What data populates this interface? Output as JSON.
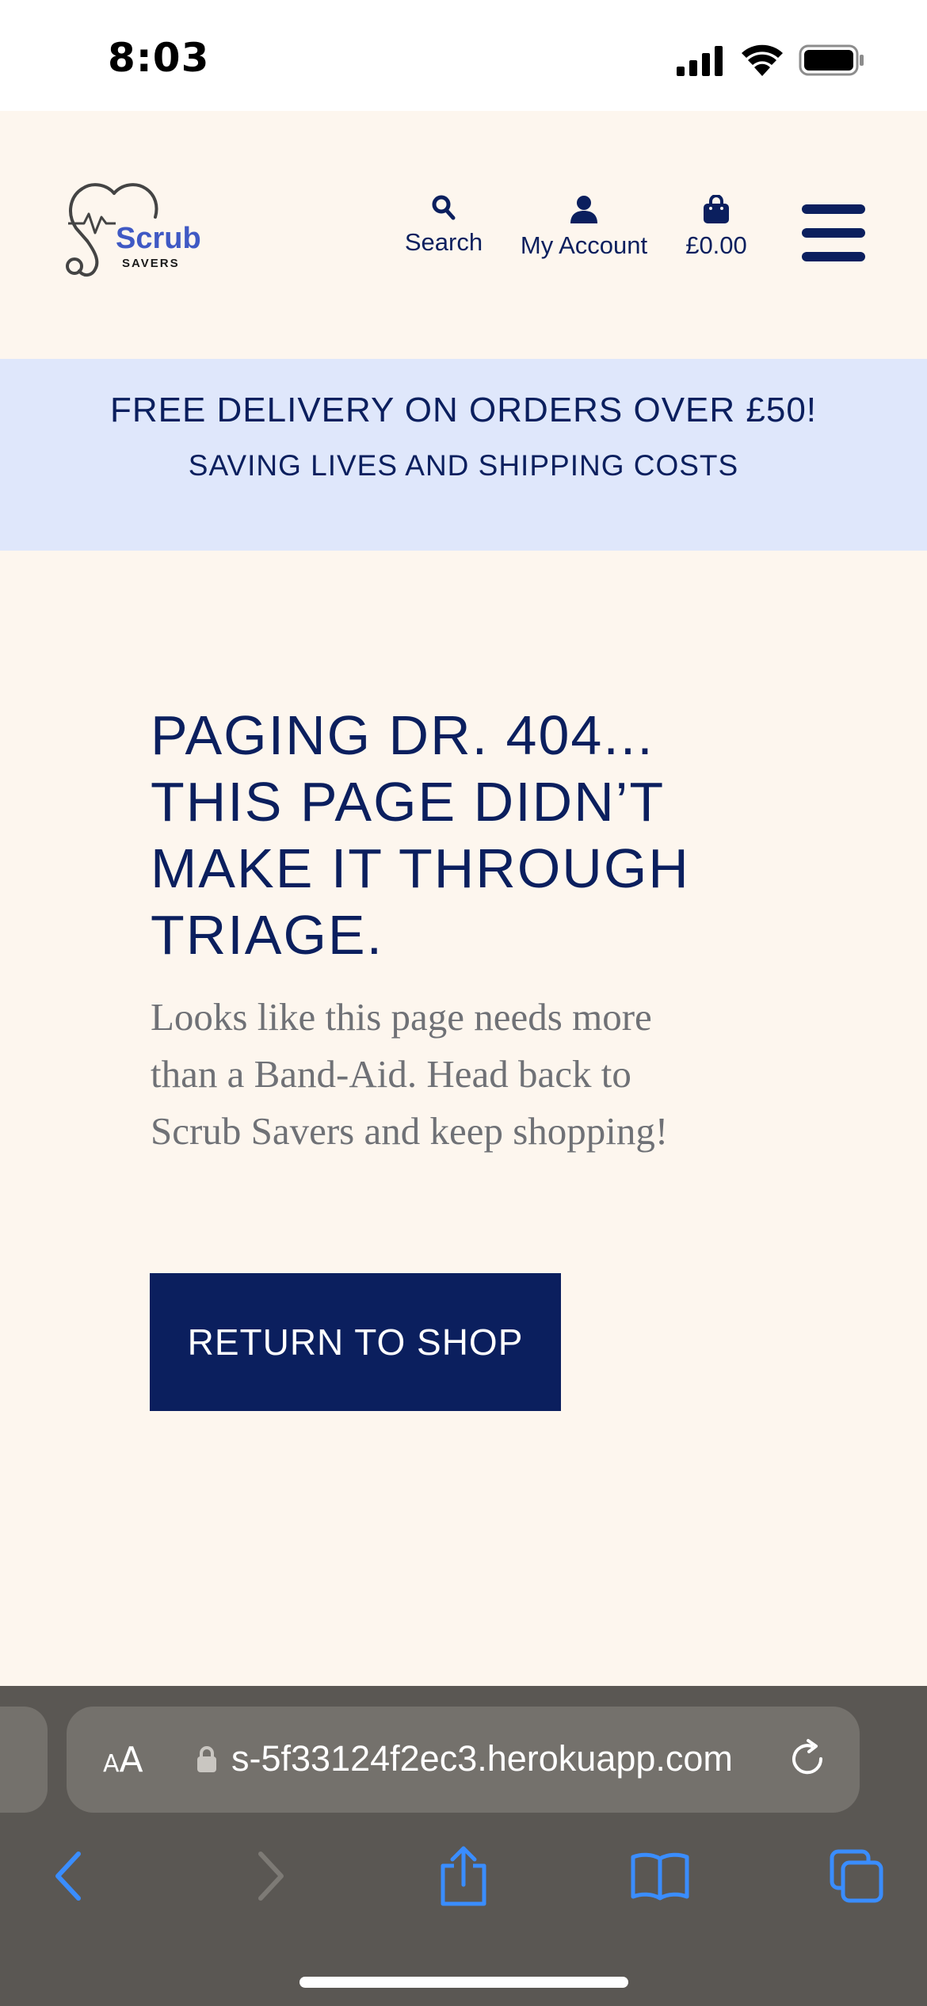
{
  "status_bar": {
    "time": "8:03",
    "icons": [
      "signal-icon",
      "wifi-icon",
      "battery-icon"
    ]
  },
  "header": {
    "logo": {
      "name": "Scrub",
      "tagline": "SAVERS",
      "icon": "stethoscope-heart-icon",
      "brand_color": "#3f59c4"
    },
    "search_label": "Search",
    "account_label": "My Account",
    "cart_total": "£0.00",
    "icons": [
      "search-icon",
      "user-icon",
      "shopping-bag-icon",
      "menu-icon"
    ]
  },
  "banner": {
    "title": "FREE DELIVERY ON ORDERS OVER £50!",
    "subtitle": "SAVING LIVES AND SHIPPING COSTS"
  },
  "main": {
    "heading_lines": [
      "PAGING DR. 404...",
      "THIS PAGE DIDN’T",
      "MAKE IT THROUGH",
      "TRIAGE."
    ],
    "message_lines": [
      "Looks like this page needs more",
      "than a Band-Aid. Head back to",
      "Scrub Savers and keep shopping!"
    ],
    "button_label": "RETURN TO SHOP"
  },
  "browser": {
    "text_size_small": "A",
    "text_size_large": "A",
    "url": "s-5f33124f2ec3.herokuapp.com",
    "toolbar_icons": [
      "back-icon",
      "forward-icon",
      "share-icon",
      "bookmarks-icon",
      "tabs-icon"
    ]
  },
  "colors": {
    "navy": "#0b1f5e",
    "page_background": "#fdf6ee",
    "banner_background": "#dfe7fb",
    "body_text": "#6f7176",
    "browser_chrome": "#5a5753",
    "browser_accent": "#3a8dff"
  }
}
